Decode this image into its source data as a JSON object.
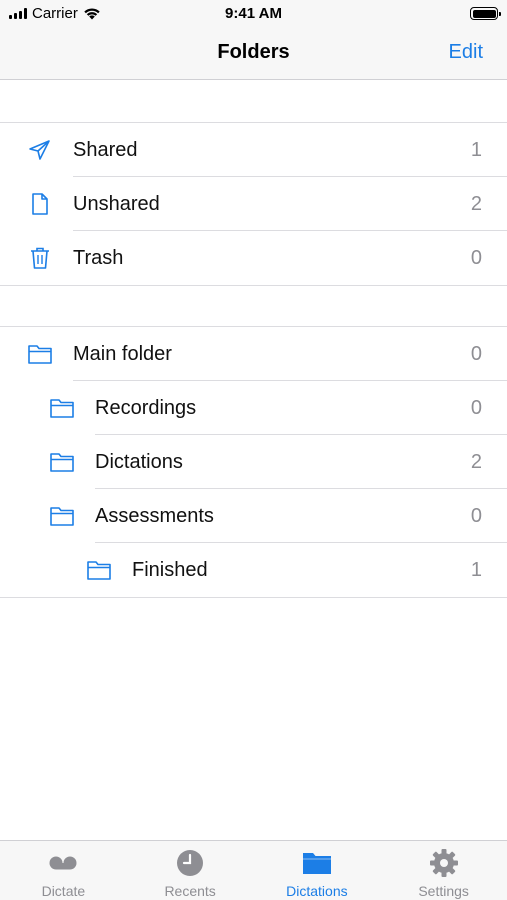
{
  "status_bar": {
    "carrier": "Carrier",
    "time": "9:41 AM"
  },
  "nav": {
    "title": "Folders",
    "edit_label": "Edit"
  },
  "sections": {
    "system": [
      {
        "label": "Shared",
        "count": "1",
        "icon": "paperplane-icon"
      },
      {
        "label": "Unshared",
        "count": "2",
        "icon": "document-icon"
      },
      {
        "label": "Trash",
        "count": "0",
        "icon": "trash-icon"
      }
    ],
    "folders": [
      {
        "label": "Main folder",
        "count": "0",
        "icon": "folder-icon",
        "depth": 0
      },
      {
        "label": "Recordings",
        "count": "0",
        "icon": "folder-icon",
        "depth": 1
      },
      {
        "label": "Dictations",
        "count": "2",
        "icon": "folder-icon",
        "depth": 1
      },
      {
        "label": "Assessments",
        "count": "0",
        "icon": "folder-icon",
        "depth": 1
      },
      {
        "label": "Finished",
        "count": "1",
        "icon": "folder-icon",
        "depth": 2
      }
    ]
  },
  "tabs": [
    {
      "label": "Dictate",
      "icon": "voicemail-icon",
      "active": false
    },
    {
      "label": "Recents",
      "icon": "clock-icon",
      "active": false
    },
    {
      "label": "Dictations",
      "icon": "folder-fill-icon",
      "active": true
    },
    {
      "label": "Settings",
      "icon": "gear-icon",
      "active": false
    }
  ],
  "colors": {
    "accent": "#1c7ee6",
    "inactive": "#8e8e93",
    "separator": "#dcdce0"
  }
}
